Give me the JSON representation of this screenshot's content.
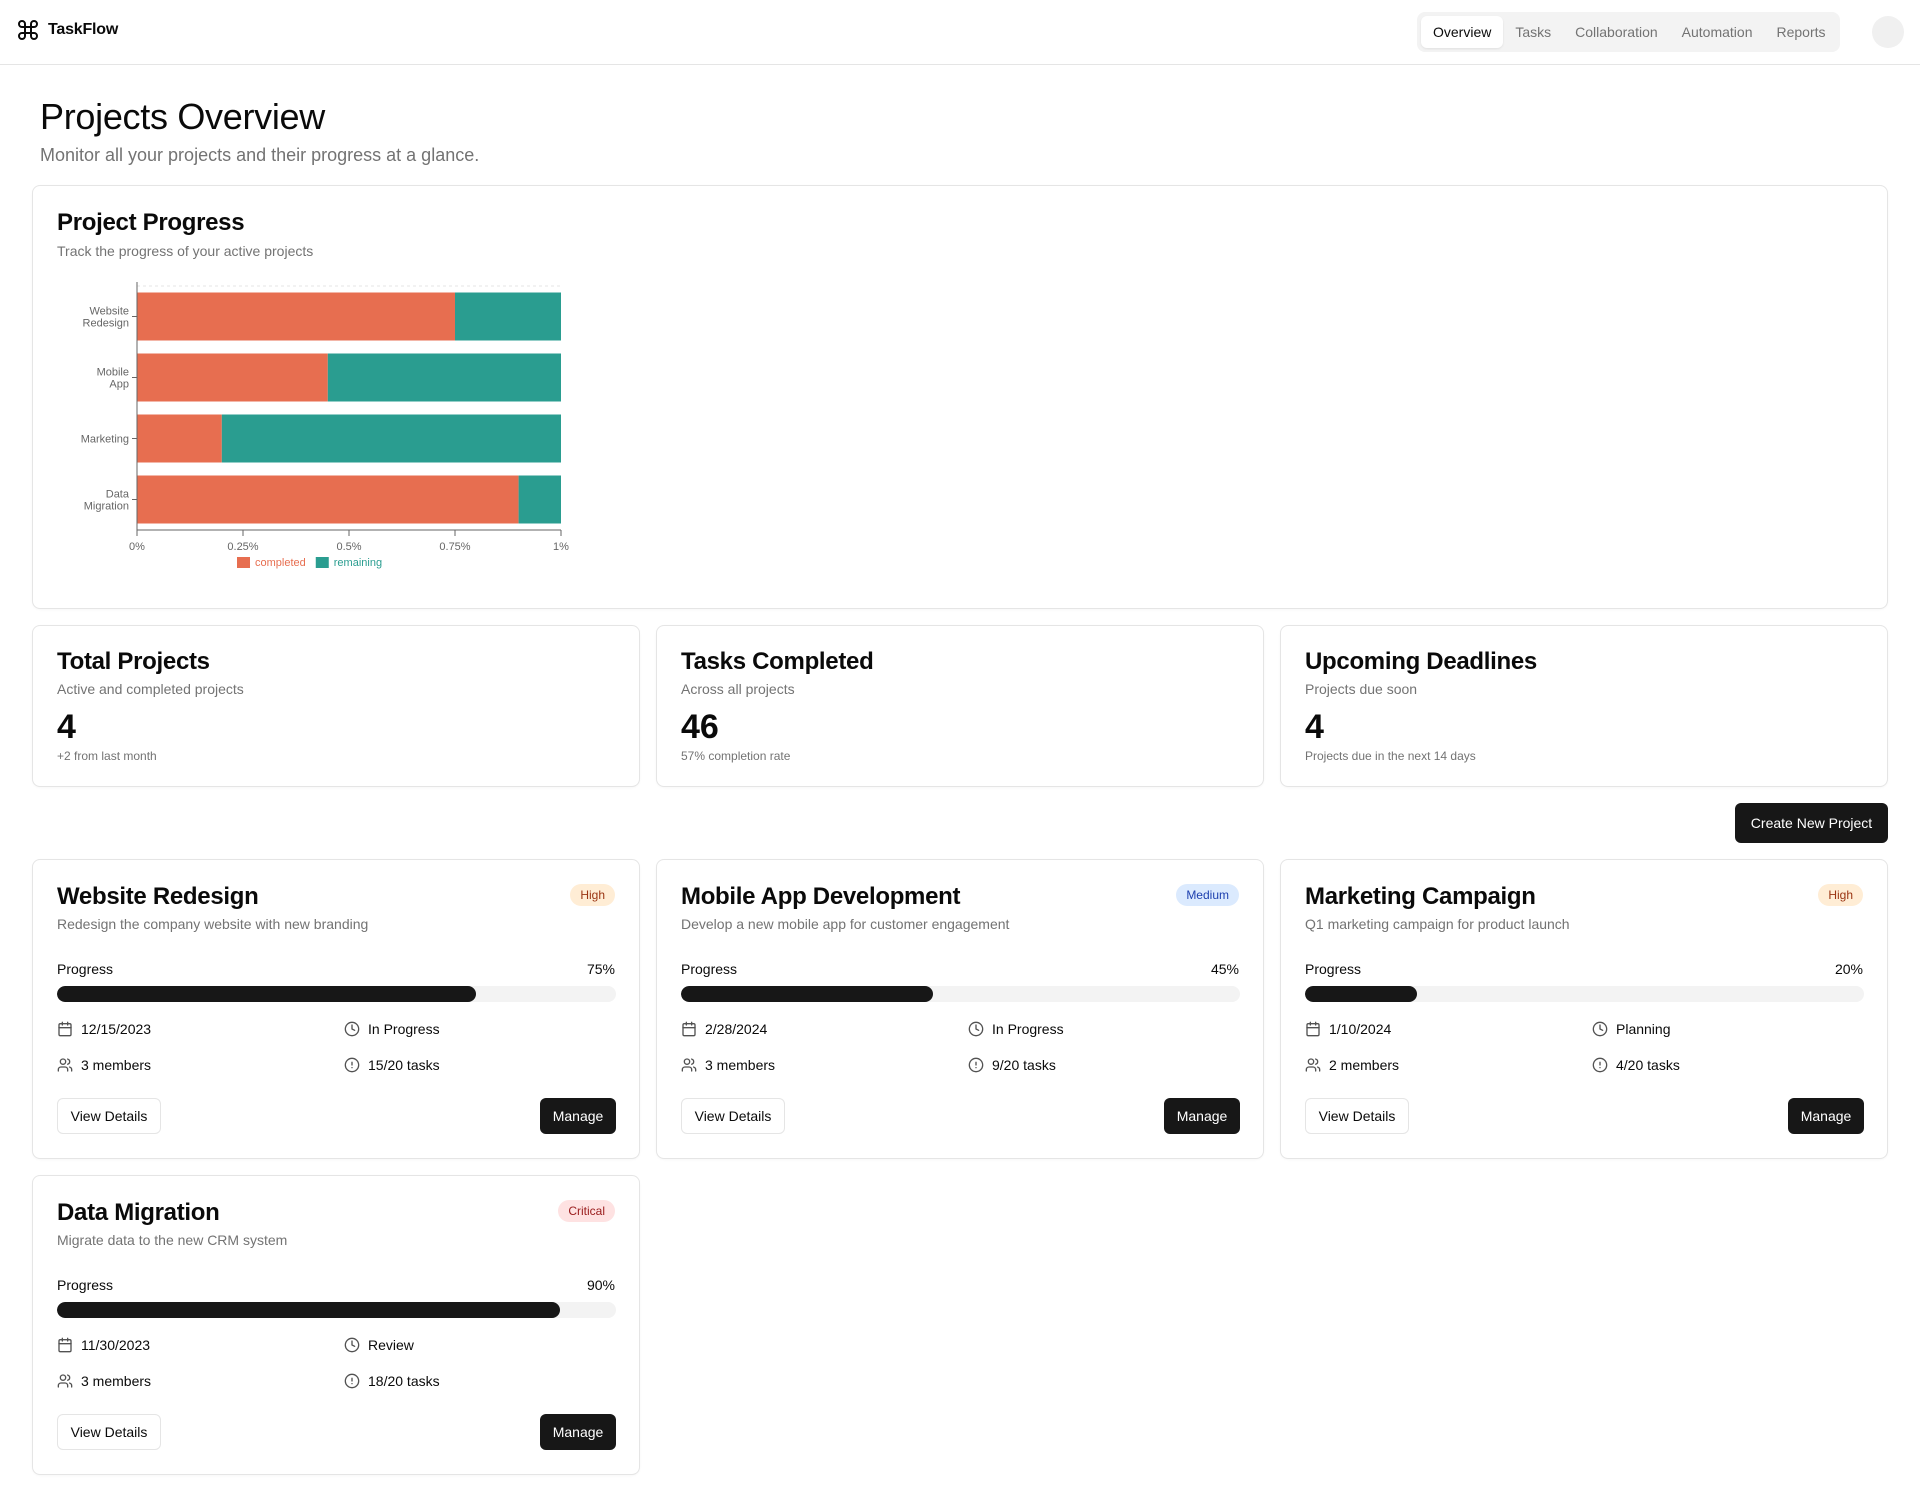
{
  "app": {
    "name": "TaskFlow"
  },
  "nav": {
    "items": [
      {
        "label": "Overview",
        "active": true
      },
      {
        "label": "Tasks",
        "active": false
      },
      {
        "label": "Collaboration",
        "active": false
      },
      {
        "label": "Automation",
        "active": false
      },
      {
        "label": "Reports",
        "active": false
      }
    ]
  },
  "page": {
    "title": "Projects Overview",
    "subtitle": "Monitor all your projects and their progress at a glance."
  },
  "chart_card": {
    "title": "Project Progress",
    "description": "Track the progress of your active projects"
  },
  "chart_data": {
    "type": "bar",
    "orientation": "horizontal",
    "stacked": true,
    "categories": [
      [
        "Website",
        "Redesign"
      ],
      [
        "Mobile",
        "App"
      ],
      [
        "Marketing"
      ],
      [
        "Data",
        "Migration"
      ]
    ],
    "series": [
      {
        "name": "completed",
        "color": "#e76e50",
        "values": [
          0.75,
          0.45,
          0.2,
          0.9
        ]
      },
      {
        "name": "remaining",
        "color": "#2a9d90",
        "values": [
          0.25,
          0.55,
          0.8,
          0.1
        ]
      }
    ],
    "xticks": [
      "0%",
      "0.25%",
      "0.5%",
      "0.75%",
      "1%"
    ],
    "xlim": [
      0,
      1
    ],
    "legend": "bottom",
    "grid": false
  },
  "stats": [
    {
      "title": "Total Projects",
      "description": "Active and completed projects",
      "value": "4",
      "note": "+2 from last month"
    },
    {
      "title": "Tasks Completed",
      "description": "Across all projects",
      "value": "46",
      "note": "57% completion rate"
    },
    {
      "title": "Upcoming Deadlines",
      "description": "Projects due soon",
      "value": "4",
      "note": "Projects due in the next 14 days"
    }
  ],
  "actions": {
    "create_label": "Create New Project"
  },
  "projects": [
    {
      "title": "Website Redesign",
      "description": "Redesign the company website with new branding",
      "priority": "High",
      "progress_label": "Progress",
      "progress": 75,
      "progress_text": "75%",
      "date": "12/15/2023",
      "status": "In Progress",
      "members": "3 members",
      "tasks": "15/20 tasks",
      "view_label": "View Details",
      "manage_label": "Manage"
    },
    {
      "title": "Mobile App Development",
      "description": "Develop a new mobile app for customer engagement",
      "priority": "Medium",
      "progress_label": "Progress",
      "progress": 45,
      "progress_text": "45%",
      "date": "2/28/2024",
      "status": "In Progress",
      "members": "3 members",
      "tasks": "9/20 tasks",
      "view_label": "View Details",
      "manage_label": "Manage"
    },
    {
      "title": "Marketing Campaign",
      "description": "Q1 marketing campaign for product launch",
      "priority": "High",
      "progress_label": "Progress",
      "progress": 20,
      "progress_text": "20%",
      "date": "1/10/2024",
      "status": "Planning",
      "members": "2 members",
      "tasks": "4/20 tasks",
      "view_label": "View Details",
      "manage_label": "Manage"
    },
    {
      "title": "Data Migration",
      "description": "Migrate data to the new CRM system",
      "priority": "Critical",
      "progress_label": "Progress",
      "progress": 90,
      "progress_text": "90%",
      "date": "11/30/2023",
      "status": "Review",
      "members": "3 members",
      "tasks": "18/20 tasks",
      "view_label": "View Details",
      "manage_label": "Manage"
    }
  ],
  "icons": {
    "logo": "command-icon",
    "date": "calendar-icon",
    "status": "clock-icon",
    "members": "users-icon",
    "tasks": "alert-circle-icon"
  }
}
